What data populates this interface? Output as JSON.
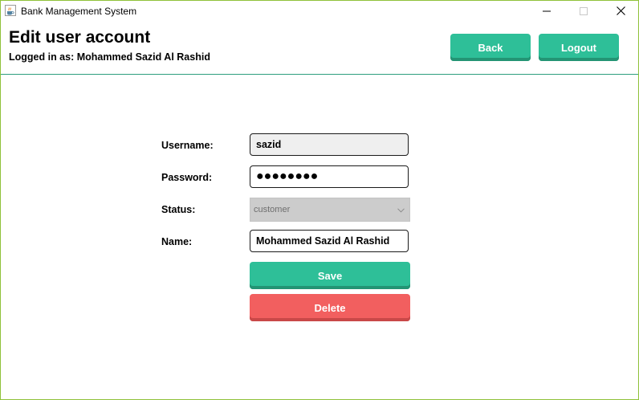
{
  "window": {
    "title": "Bank Management System",
    "icon": "java-cup-icon",
    "controls": {
      "minimize_icon": "minimize-icon",
      "maximize_icon": "maximize-icon",
      "close_icon": "close-icon"
    }
  },
  "header": {
    "title": "Edit user account",
    "logged_in_text": "Logged in as: Mohammed Sazid Al Rashid",
    "back_label": "Back",
    "logout_label": "Logout"
  },
  "form": {
    "username_label": "Username:",
    "username_value": "sazid",
    "password_label": "Password:",
    "password_value": "●●●●●●●●",
    "status_label": "Status:",
    "status_value": "customer",
    "name_label": "Name:",
    "name_value": "Mohammed Sazid Al Rashid",
    "save_label": "Save",
    "delete_label": "Delete"
  },
  "colors": {
    "accent_green": "#2ebf98",
    "danger_red": "#f25f5f",
    "window_border": "#8fc23a",
    "header_divider": "#2e9e7e"
  }
}
